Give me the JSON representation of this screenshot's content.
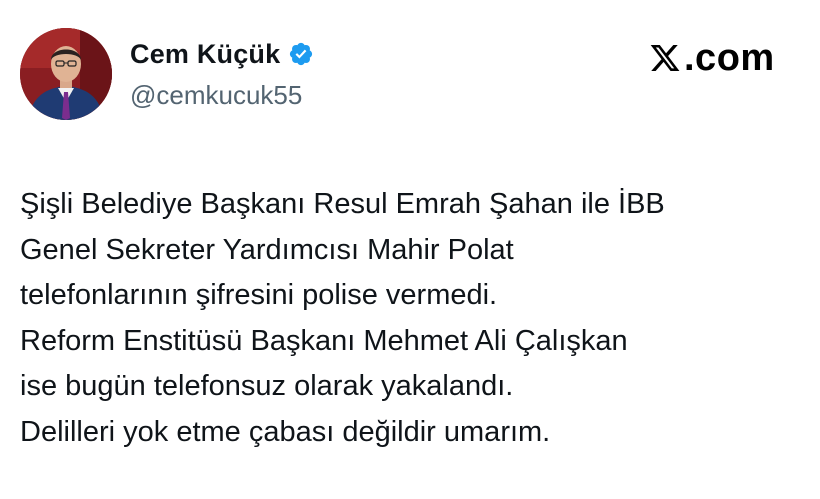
{
  "author": {
    "display_name": "Cem Küçük",
    "handle": "@cemkucuk55",
    "avatar_icon": "profile-photo",
    "verified_icon": "verified-badge-icon",
    "verified_color": "#1d9bf0"
  },
  "brand": {
    "text": ".com",
    "logo_icon": "x-logo-icon"
  },
  "tweet": {
    "lines": [
      "Şişli Belediye Başkanı Resul Emrah Şahan ile İBB",
      "Genel Sekreter Yardımcısı Mahir Polat",
      "telefonlarının şifresini polise vermedi.",
      "Reform Enstitüsü Başkanı Mehmet Ali Çalışkan",
      "ise bugün telefonsuz olarak yakalandı.",
      "Delilleri yok etme çabası değildir umarım."
    ]
  }
}
